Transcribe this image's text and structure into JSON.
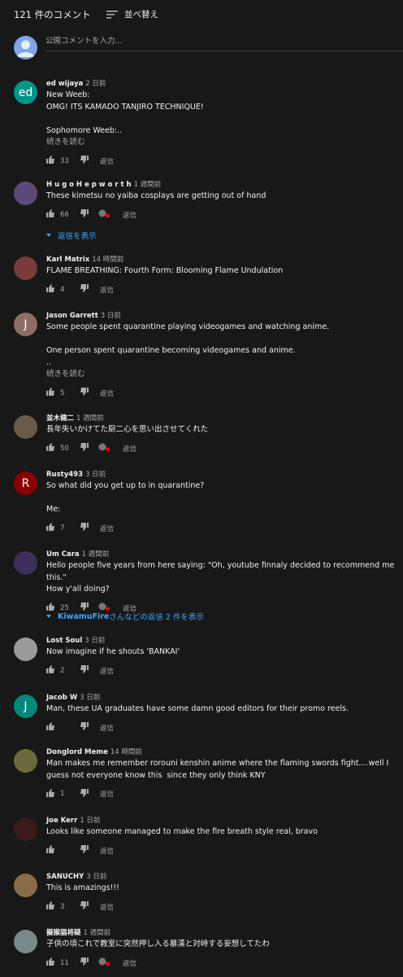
{
  "header": {
    "count": "121 件のコメント",
    "sort_label": "並べ替え"
  },
  "add_comment": {
    "placeholder": "公開コメントを入力..."
  },
  "labels": {
    "reply": "返信",
    "show_replies": "返信を表示",
    "read_more": "続きを読む"
  },
  "comments": [
    {
      "author": "ed wijaya",
      "time": "2 日前",
      "text": "New Weeb:\nOMG! ITS KAMADO TANJIRO TECHNIQUE!\n\nSophomore Weeb:..",
      "read_more": "続きを読む",
      "likes": "33",
      "creator_heart": false,
      "avatar": {
        "kind": "letter",
        "letter": "ed",
        "color": "#009688"
      }
    },
    {
      "author": "H u g o H e p w o r t h",
      "time": "1 週間前",
      "text": "These kimetsu no yaiba cosplays are getting out of hand",
      "likes": "66",
      "creator_heart": true,
      "avatar": {
        "kind": "image",
        "color": "#5b4a78"
      },
      "replies": "返信を表示"
    },
    {
      "author": "Karl Matrix",
      "time": "14 時間前",
      "text": "FLAME BREATHING: Fourth Form: Blooming Flame Undulation",
      "likes": "4",
      "creator_heart": false,
      "avatar": {
        "kind": "image",
        "color": "#7a3b3b"
      }
    },
    {
      "author": "Jason Garrett",
      "time": "3 日前",
      "text": "Some people spent quarantine playing videogames and watching anime.\n\nOne person spent quarantine becoming videogames and anime.\n..",
      "read_more": "続きを読む",
      "likes": "5",
      "creator_heart": false,
      "avatar": {
        "kind": "letter",
        "letter": "J",
        "color": "#8d6e63"
      }
    },
    {
      "author": "並木健二",
      "time": "1 週間前",
      "text": "長年失いかけてた厨二心を思い出させてくれた",
      "likes": "50",
      "creator_heart": true,
      "avatar": {
        "kind": "image",
        "color": "#6b5a4a"
      }
    },
    {
      "author": "Rusty493",
      "time": "3 日前",
      "text": "So what did you get up to in quarantine?\n\nMe:",
      "likes": "7",
      "creator_heart": false,
      "avatar": {
        "kind": "letter",
        "letter": "R",
        "color": "#8b0000"
      }
    },
    {
      "author": "Um Cara",
      "time": "1 週間前",
      "text": "Hello people five years from here saying: \"Oh, youtube finnaly decided to recommend me this.\"\nHow y'all doing?",
      "likes": "25",
      "creator_heart": true,
      "avatar": {
        "kind": "image",
        "color": "#3d2f5a"
      },
      "replies_prefix": "KiwamuFire",
      "replies_suffix": " さんなどの返信 2 件を表示"
    },
    {
      "author": "Lost Soul",
      "time": "3 日前",
      "text": "Now imagine if he shouts 'BANKAI'",
      "likes": "2",
      "creator_heart": false,
      "avatar": {
        "kind": "image",
        "color": "#9a9a9a"
      }
    },
    {
      "author": "Jacob W",
      "time": "3 日前",
      "text": "Man, these UA graduates have some damn good editors for their promo reels.",
      "likes": "",
      "creator_heart": false,
      "avatar": {
        "kind": "letter",
        "letter": "J",
        "color": "#00897b"
      }
    },
    {
      "author": "Donglord Meme",
      "time": "14 時間前",
      "text": "Man makes me remember rorouni kenshin anime where the flaming swords fight....well I guess not everyone know this  since they only think KNY",
      "likes": "1",
      "creator_heart": false,
      "avatar": {
        "kind": "image",
        "color": "#6b6a3a"
      }
    },
    {
      "author": "Joe Kerr",
      "time": "1 日前",
      "text": "Looks like someone managed to make the fire breath style real, bravo",
      "likes": "",
      "creator_heart": false,
      "avatar": {
        "kind": "image",
        "color": "#3a1a1a"
      }
    },
    {
      "author": "SANUCHY",
      "time": "3 日前",
      "text": "This is amazings!!!",
      "likes": "3",
      "creator_heart": false,
      "avatar": {
        "kind": "image",
        "color": "#8a6b4a"
      }
    },
    {
      "author": "擬猴猖将疑",
      "time": "1 週間前",
      "text": "子供の頃これで教室に突然押し入る暴漢と対峙する妄想してたわ",
      "likes": "11",
      "creator_heart": true,
      "avatar": {
        "kind": "image",
        "color": "#7a8a8a"
      }
    }
  ],
  "colors": {
    "background": "#181818",
    "text": "#f1f1f1",
    "muted": "#aaaaaa",
    "link": "#3ea6ff",
    "heart": "#ff0000"
  },
  "icons": {
    "sort": "sort-icon",
    "like": "thumb-up-icon",
    "dislike": "thumb-down-icon",
    "heart": "creator-heart-icon",
    "expand": "chevron-down-icon"
  }
}
